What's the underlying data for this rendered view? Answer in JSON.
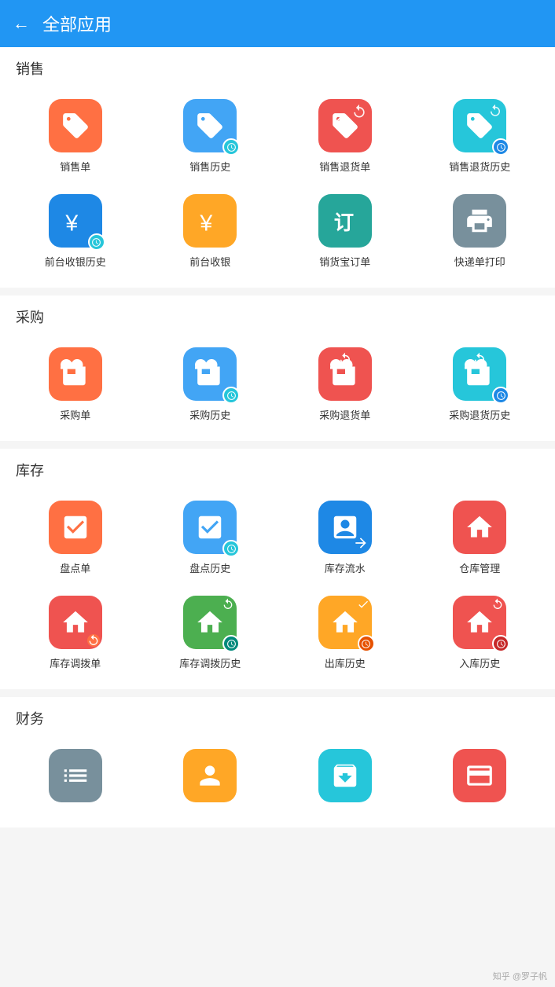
{
  "header": {
    "title": "全部应用",
    "back_label": "←"
  },
  "sections": [
    {
      "id": "sales",
      "title": "销售",
      "apps": [
        {
          "id": "sales-order",
          "label": "销售单",
          "icon": "tag",
          "bg": "orange",
          "clock": false
        },
        {
          "id": "sales-history",
          "label": "销售历史",
          "icon": "tag-clock",
          "bg": "blue",
          "clock": true,
          "clock_color": "cyan"
        },
        {
          "id": "sales-return",
          "label": "销售退货单",
          "icon": "tag-refresh",
          "bg": "red",
          "clock": false
        },
        {
          "id": "sales-return-history",
          "label": "销售退货历史",
          "icon": "tag-refresh-clock",
          "bg": "cyan",
          "clock": true,
          "clock_color": "blue"
        },
        {
          "id": "cashier-history",
          "label": "前台收银历史",
          "icon": "yen-clock",
          "bg": "blue-dark",
          "clock": true,
          "clock_color": "cyan"
        },
        {
          "id": "cashier",
          "label": "前台收银",
          "icon": "yen",
          "bg": "gold",
          "clock": false
        },
        {
          "id": "sales-treasure",
          "label": "销货宝订单",
          "icon": "order",
          "bg": "teal",
          "clock": false
        },
        {
          "id": "express-print",
          "label": "快递单打印",
          "icon": "printer",
          "bg": "slate",
          "clock": false
        }
      ]
    },
    {
      "id": "purchase",
      "title": "采购",
      "apps": [
        {
          "id": "purchase-order",
          "label": "采购单",
          "icon": "briefcase-plus",
          "bg": "orange",
          "clock": false
        },
        {
          "id": "purchase-history",
          "label": "采购历史",
          "icon": "briefcase-plus-clock",
          "bg": "blue",
          "clock": true,
          "clock_color": "cyan"
        },
        {
          "id": "purchase-return",
          "label": "采购退货单",
          "icon": "briefcase-refresh",
          "bg": "red",
          "clock": false
        },
        {
          "id": "purchase-return-history",
          "label": "采购退货历史",
          "icon": "briefcase-refresh-clock",
          "bg": "cyan",
          "clock": true,
          "clock_color": "blue"
        }
      ]
    },
    {
      "id": "inventory",
      "title": "库存",
      "apps": [
        {
          "id": "stocktake",
          "label": "盘点单",
          "icon": "clipboard-check",
          "bg": "orange",
          "clock": false
        },
        {
          "id": "stocktake-history",
          "label": "盘点历史",
          "icon": "clipboard-check-clock",
          "bg": "blue",
          "clock": true,
          "clock_color": "cyan"
        },
        {
          "id": "inventory-flow",
          "label": "库存流水",
          "icon": "clipboard-flow",
          "bg": "blue-dark",
          "clock": false
        },
        {
          "id": "warehouse",
          "label": "仓库管理",
          "icon": "house",
          "bg": "red",
          "clock": false
        },
        {
          "id": "transfer-order",
          "label": "库存调拨单",
          "icon": "house-transfer",
          "bg": "red",
          "clock": false
        },
        {
          "id": "transfer-history",
          "label": "库存调拨历史",
          "icon": "house-transfer-clock",
          "bg": "green",
          "clock": true,
          "clock_color": "teal"
        },
        {
          "id": "outbound-history",
          "label": "出库历史",
          "icon": "outbound-clock",
          "bg": "gold",
          "clock": true,
          "clock_color": "orange"
        },
        {
          "id": "inbound-history",
          "label": "入库历史",
          "icon": "inbound-clock",
          "bg": "red",
          "clock": true,
          "clock_color": "pink"
        }
      ]
    },
    {
      "id": "finance",
      "title": "财务",
      "apps": [
        {
          "id": "finance-report",
          "label": "",
          "icon": "list",
          "bg": "slate",
          "clock": false
        },
        {
          "id": "finance-customer",
          "label": "",
          "icon": "person",
          "bg": "gold",
          "clock": false
        },
        {
          "id": "finance-box",
          "label": "",
          "icon": "box",
          "bg": "cyan",
          "clock": false
        },
        {
          "id": "finance-receipt",
          "label": "",
          "icon": "receipt",
          "bg": "red",
          "clock": false
        }
      ]
    }
  ],
  "watermark": "知乎 @罗子帆"
}
